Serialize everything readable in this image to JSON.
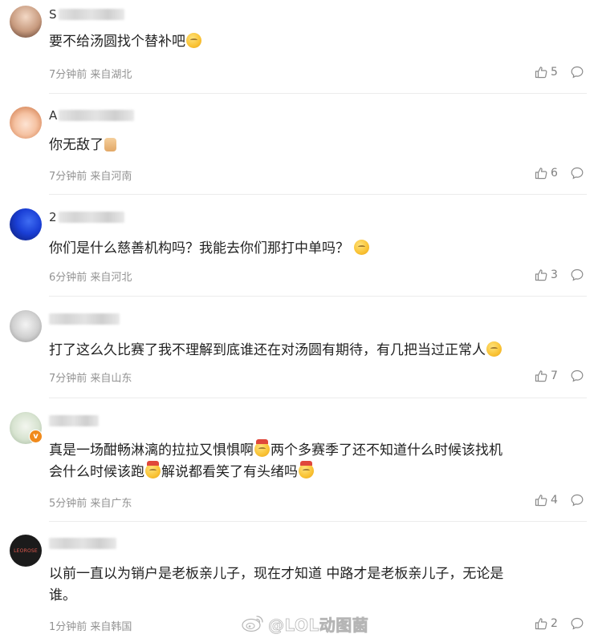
{
  "comments": [
    {
      "username_initial": "S",
      "text_parts": [
        "要不给汤圆找个替补吧"
      ],
      "emojis": [
        "laugh-cry-emoji"
      ],
      "time": "7分钟前",
      "location": "来自湖北",
      "likes": "5",
      "avatar_color": "#d8b49a"
    },
    {
      "username_initial": "A",
      "text_parts": [
        "你无敌了"
      ],
      "emojis": [
        "thumbs-up-emoji"
      ],
      "time": "7分钟前",
      "location": "来自河南",
      "likes": "6",
      "avatar_color": "#f2c5a8"
    },
    {
      "username_initial": "2",
      "text_parts": [
        "你们是什么慈善机构吗？我能去你们那打中单吗？"
      ],
      "emojis": [
        "thinking-emoji"
      ],
      "time": "6分钟前",
      "location": "来自河北",
      "likes": "3",
      "avatar_color": "#1a3fd6"
    },
    {
      "username_initial": "",
      "text_parts": [
        "打了这么久比赛了我不理解到底谁还在对汤圆有期待，有几把当过正常人"
      ],
      "emojis": [
        "thinking-emoji"
      ],
      "time": "7分钟前",
      "location": "来自山东",
      "likes": "7",
      "avatar_color": "#c9c9c9"
    },
    {
      "username_initial": "",
      "text_line1": "真是一场酣畅淋漓的拉拉又惧惧啊",
      "text_line1b": "两个多赛季了还不知道什么时候该找机",
      "text_line2a": "会什么时候该跑",
      "text_line2b": "解说都看笑了有头绪吗",
      "time": "5分钟前",
      "location": "来自广东",
      "likes": "4",
      "avatar_color": "#d7e3d0",
      "verified_color": "#f08a1c"
    },
    {
      "username_initial": "",
      "text_line1": "以前一直以为销户是老板亲儿子，现在才知道 中路才是老板亲儿子，无论是",
      "text_line2": "谁。",
      "time": "1分钟前",
      "location": "来自韩国",
      "likes": "2",
      "avatar_text": "LEOROSE",
      "avatar_color": "#1b1b1b"
    }
  ],
  "watermark": {
    "text": "@LOL动图菌"
  },
  "colors": {
    "text": "#222222",
    "meta": "#939393",
    "divider": "#ececec",
    "icon": "#8a8a8a"
  }
}
